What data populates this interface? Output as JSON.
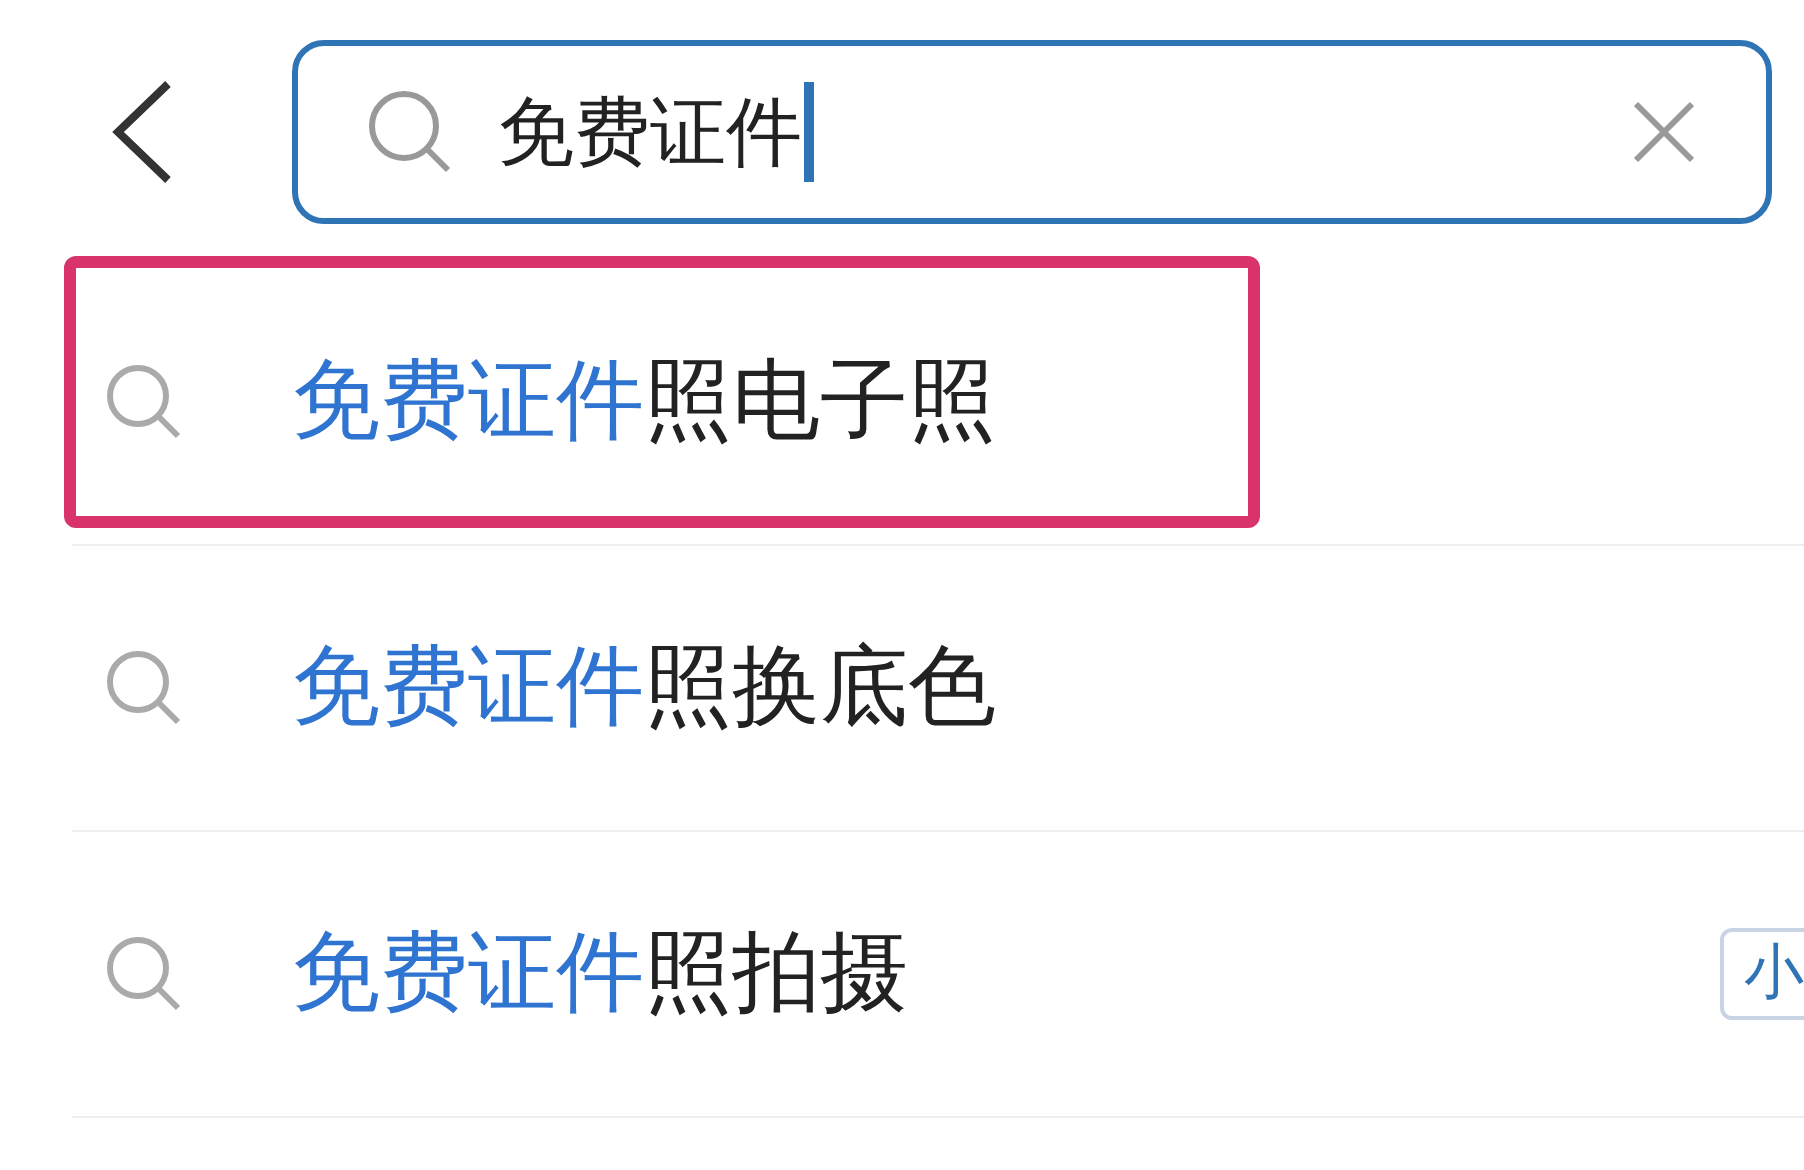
{
  "search": {
    "value": "免费证件"
  },
  "suggestions": [
    {
      "match": "免费证件",
      "rest": "照电子照",
      "highlighted": true
    },
    {
      "match": "免费证件",
      "rest": "照换底色",
      "highlighted": false
    },
    {
      "match": "免费证件",
      "rest": "照拍摄",
      "highlighted": false,
      "badge": "小"
    }
  ]
}
